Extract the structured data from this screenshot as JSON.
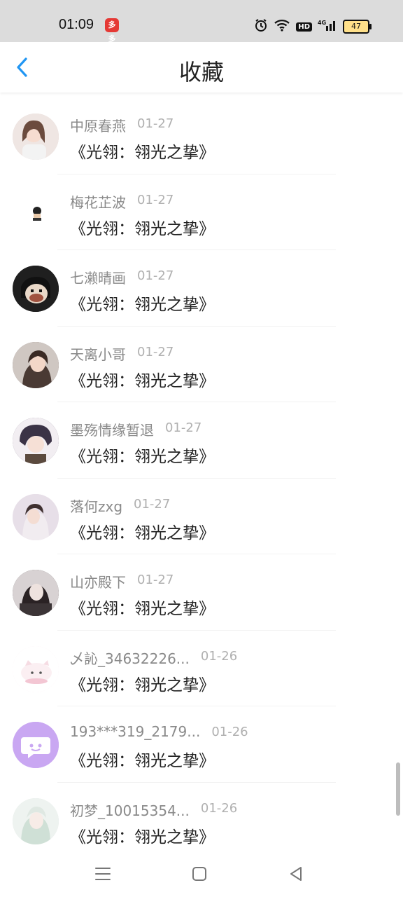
{
  "status": {
    "time": "01:09",
    "app_badge": "多多",
    "hd_label": "HD",
    "network": "4G",
    "battery": "47"
  },
  "header": {
    "title": "收藏",
    "back_icon": "chevron-left-icon"
  },
  "items": [
    {
      "name": "中原春燕",
      "date": "01-27",
      "content": "《光翎：翎光之挚》",
      "avatar_color": "#d9c9c2"
    },
    {
      "name": "梅花芷波",
      "date": "01-27",
      "content": "《光翎：翎光之挚》",
      "avatar_color": "#ffffff"
    },
    {
      "name": "七濑晴画",
      "date": "01-27",
      "content": "《光翎：翎光之挚》",
      "avatar_color": "#2b2b2b"
    },
    {
      "name": "天离小哥",
      "date": "01-27",
      "content": "《光翎：翎光之挚》",
      "avatar_color": "#6b5a55"
    },
    {
      "name": "墨殇情缘暂退",
      "date": "01-27",
      "content": "《光翎：翎光之挚》",
      "avatar_color": "#5a5166"
    },
    {
      "name": "落何zxg",
      "date": "01-27",
      "content": "《光翎：翎光之挚》",
      "avatar_color": "#e9dde5"
    },
    {
      "name": "山亦殿下",
      "date": "01-27",
      "content": "《光翎：翎光之挚》",
      "avatar_color": "#3d3537"
    },
    {
      "name": "乄訫_34632226...",
      "date": "01-26",
      "content": "《光翎：翎光之挚》",
      "avatar_color": "#fbe7ee"
    },
    {
      "name": "193***319_2179...",
      "date": "01-26",
      "content": "《光翎：翎光之挚》",
      "avatar_color": "#c9a7f2"
    },
    {
      "name": "初梦_10015354...",
      "date": "01-26",
      "content": "《光翎：翎光之挚》",
      "avatar_color": "#dbe6e0"
    }
  ],
  "navbar": {
    "menu_icon": "menu-icon",
    "home_icon": "square-home-icon",
    "back_icon": "triangle-back-icon"
  }
}
